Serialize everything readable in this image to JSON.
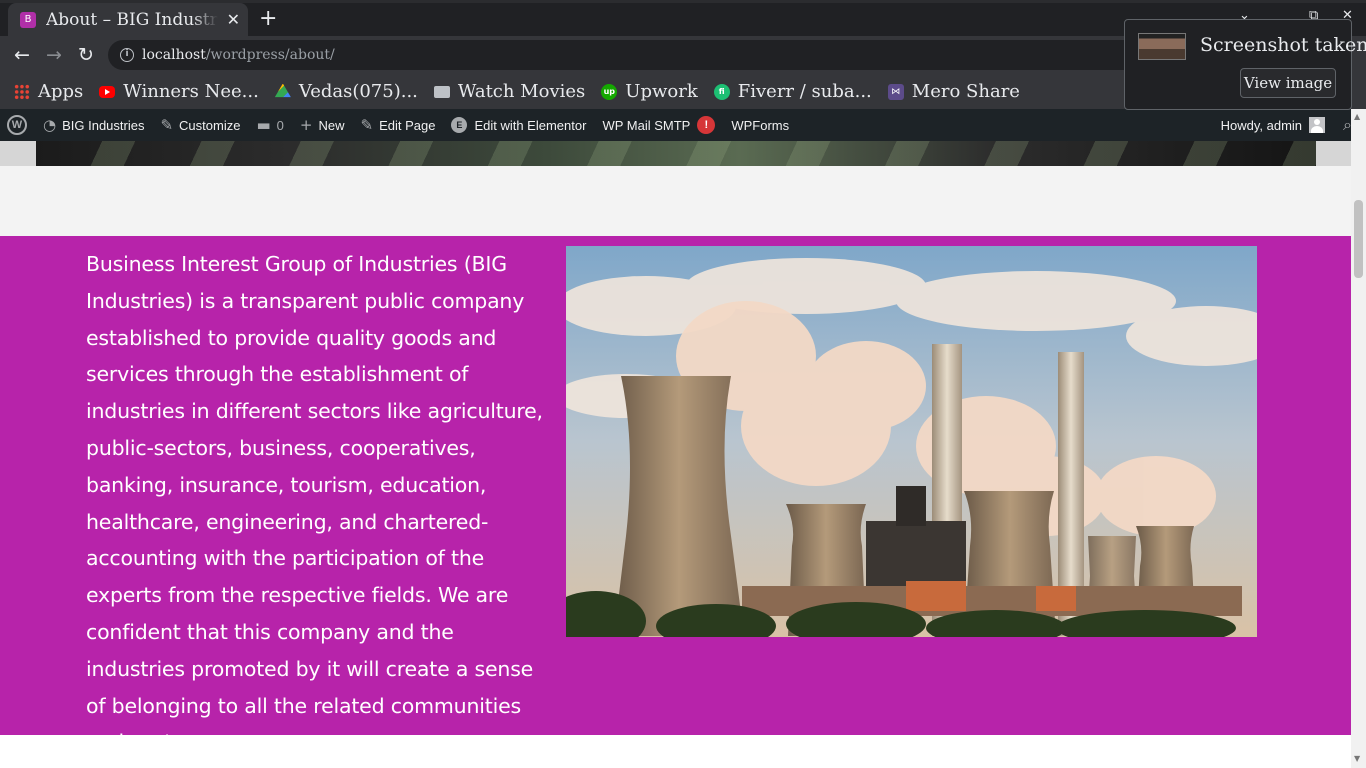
{
  "browser": {
    "tab_title": "About – BIG Industries",
    "tab_favicon": "B",
    "tab_close": "✕",
    "new_tab": "+",
    "url_host": "localhost",
    "url_path": "/wordpress/about/",
    "back": "←",
    "forward": "→",
    "reload": "↻"
  },
  "bookmarks": [
    {
      "label": "Apps",
      "icon": "apps-grid-icon"
    },
    {
      "label": "Winners Nee...",
      "icon": "youtube-icon"
    },
    {
      "label": "Vedas(075)...",
      "icon": "google-drive-icon"
    },
    {
      "label": "Watch Movies",
      "icon": "folder-icon"
    },
    {
      "label": "Upwork",
      "icon": "upwork-icon"
    },
    {
      "label": "Fiverr / suba...",
      "icon": "fiverr-icon"
    },
    {
      "label": "Mero Share",
      "icon": "mero-share-icon"
    }
  ],
  "notification": {
    "title": "Screenshot taken",
    "button": "View image"
  },
  "adminbar": {
    "site_name": "BIG Industries",
    "customize": "Customize",
    "comments_count": "0",
    "new": "New",
    "edit_page": "Edit Page",
    "edit_elementor": "Edit with Elementor",
    "wp_mail_smtp": "WP Mail SMTP",
    "wp_mail_badge": "!",
    "wpforms": "WPForms",
    "howdy": "Howdy, admin"
  },
  "content": {
    "about_text": "Business Interest Group of Industries (BIG Industries) is a transparent public company established to provide quality goods and services through the establishment of industries in different sectors like agriculture, public-sectors, business, cooperatives, banking, insurance, tourism, education, healthcare, engineering, and chartered-accounting with the participation of the experts from the respective fields. We are confident that this company and the industries promoted by it will create a sense of belonging to all the related communities and sectors."
  },
  "colors": {
    "section_bg": "#b723aa",
    "adminbar_bg": "#1d2327",
    "browser_bg": "#202124"
  }
}
